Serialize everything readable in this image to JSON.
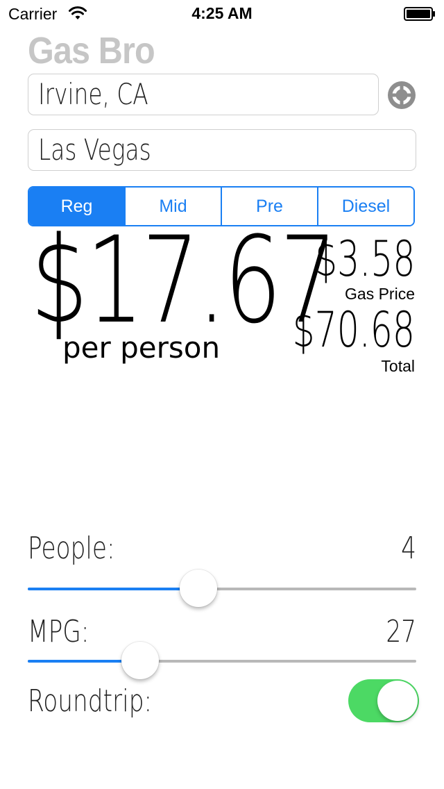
{
  "status_bar": {
    "carrier": "Carrier",
    "time": "4:25 AM",
    "icons": [
      "wifi-icon",
      "battery-icon"
    ]
  },
  "app": {
    "title": "Gas Bro",
    "title_color": "#c6c6c6",
    "accent_color": "#1a7ff3",
    "toggle_on_color": "#4cd964"
  },
  "route": {
    "origin_value": "Irvine, CA",
    "destination_value": "Las Vegas",
    "locate_icon": "crosshair-icon"
  },
  "fuel_grades": {
    "options": [
      "Reg",
      "Mid",
      "Pre",
      "Diesel"
    ],
    "selected": "Reg"
  },
  "results": {
    "per_person_amount": "$17.67",
    "per_person_label": "per person",
    "gas_price": "$3.58",
    "gas_price_label": "Gas Price",
    "total": "$70.68",
    "total_label": "Total"
  },
  "controls": {
    "people_label": "People:",
    "people_value": "4",
    "people_slider_fraction": 0.44,
    "mpg_label": "MPG:",
    "mpg_value": "27",
    "mpg_slider_fraction": 0.29,
    "roundtrip_label": "Roundtrip:",
    "roundtrip_on": true
  }
}
